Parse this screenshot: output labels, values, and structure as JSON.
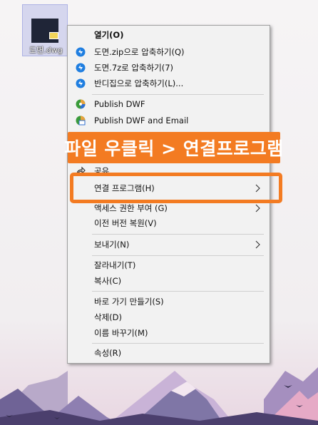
{
  "desktop_file": {
    "name": "도면.dwg",
    "icon": "dwg-file-icon"
  },
  "context_menu": {
    "items": [
      {
        "label": "열기(O)",
        "bold": true,
        "icon": ""
      },
      {
        "label": "도면.zip으로 압축하기(Q)",
        "icon": "bandizip-icon"
      },
      {
        "label": "도면.7z로 압축하기(7)",
        "icon": "bandizip-icon"
      },
      {
        "label": "반디집으로 압축하기(L)...",
        "icon": "bandizip-icon"
      },
      {
        "label": "Publish DWF",
        "icon": "autodesk-dwf-icon"
      },
      {
        "label": "Publish DWF and Email",
        "icon": "autodesk-dwf-email-icon"
      },
      {
        "label": "공유",
        "icon": "share-icon"
      },
      {
        "label": "연결 프로그램(H)",
        "submenu": true
      },
      {
        "label": "액세스 권한 부여 (G)",
        "submenu": true
      },
      {
        "label": "이전 버전 복원(V)"
      },
      {
        "label": "보내기(N)",
        "submenu": true
      },
      {
        "label": "잘라내기(T)"
      },
      {
        "label": "복사(C)"
      },
      {
        "label": "바로 가기 만들기(S)"
      },
      {
        "label": "삭제(D)"
      },
      {
        "label": "이름 바꾸기(M)"
      },
      {
        "label": "속성(R)"
      }
    ]
  },
  "annotation": {
    "banner_text": "파일 우클릭 > 연결프로그램",
    "accent_color": "#f37b22"
  }
}
